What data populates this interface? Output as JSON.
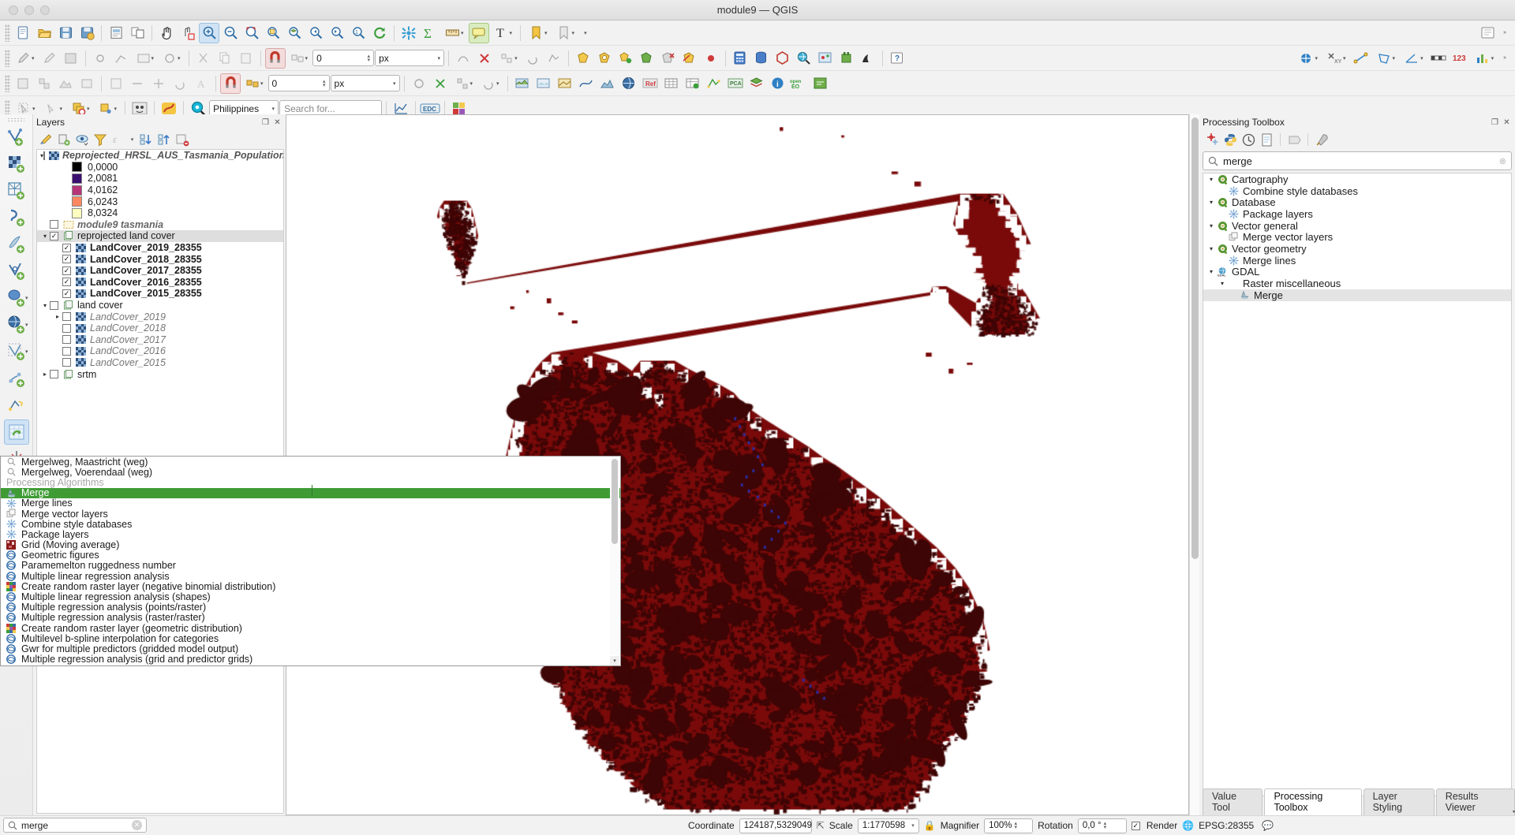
{
  "window": {
    "title": "module9 — QGIS"
  },
  "toolbar3": {
    "value": "0",
    "unit": "px",
    "country": "Philippines",
    "search_placeholder": "Search for..."
  },
  "layers_panel": {
    "title": "Layers",
    "tools": [
      "open-layer-styling",
      "add-group",
      "manage-visibility",
      "filter-legend",
      "expression-filter",
      "expand-all",
      "collapse-all",
      "remove-layer"
    ],
    "items": [
      {
        "label": "Reprojected_HRSL_AUS_Tasmania_Population",
        "style": "bolditalic",
        "indent": 0,
        "checkbox": "unchecked",
        "expander": "down",
        "icon": "raster"
      },
      {
        "label": "0,0000",
        "style": "swatch",
        "color": "#000000",
        "indent": 1
      },
      {
        "label": "2,0081",
        "style": "swatch",
        "color": "#3b0f70",
        "indent": 1
      },
      {
        "label": "4,0162",
        "style": "swatch",
        "color": "#b63679",
        "indent": 1
      },
      {
        "label": "6,0243",
        "style": "swatch",
        "color": "#fb8861",
        "indent": 1
      },
      {
        "label": "8,0324",
        "style": "swatch",
        "color": "#fcfdbf",
        "indent": 1
      },
      {
        "label": "module9 tasmania",
        "style": "grayitalic",
        "indent": 0,
        "checkbox": "unchecked",
        "icon": "vector-dashed"
      },
      {
        "label": "reprojected land cover",
        "style": "plain",
        "indent": 0,
        "checkbox": "checked",
        "expander": "down",
        "icon": "group",
        "selected": true
      },
      {
        "label": "LandCover_2019_28355",
        "style": "bold",
        "indent": 1,
        "checkbox": "checked",
        "icon": "raster"
      },
      {
        "label": "LandCover_2018_28355",
        "style": "bold",
        "indent": 1,
        "checkbox": "checked",
        "icon": "raster"
      },
      {
        "label": "LandCover_2017_28355",
        "style": "bold",
        "indent": 1,
        "checkbox": "checked",
        "icon": "raster"
      },
      {
        "label": "LandCover_2016_28355",
        "style": "bold",
        "indent": 1,
        "checkbox": "checked",
        "icon": "raster"
      },
      {
        "label": "LandCover_2015_28355",
        "style": "bold",
        "indent": 1,
        "checkbox": "checked",
        "icon": "raster"
      },
      {
        "label": "land cover",
        "style": "plain",
        "indent": 0,
        "checkbox": "unchecked",
        "expander": "down",
        "icon": "group"
      },
      {
        "label": "LandCover_2019",
        "style": "italic",
        "indent": 1,
        "checkbox": "unchecked",
        "expander": "right",
        "icon": "raster"
      },
      {
        "label": "LandCover_2018",
        "style": "italic",
        "indent": 1,
        "checkbox": "unchecked",
        "icon": "raster"
      },
      {
        "label": "LandCover_2017",
        "style": "italic",
        "indent": 1,
        "checkbox": "unchecked",
        "icon": "raster"
      },
      {
        "label": "LandCover_2016",
        "style": "italic",
        "indent": 1,
        "checkbox": "unchecked",
        "icon": "raster"
      },
      {
        "label": "LandCover_2015",
        "style": "italic",
        "indent": 1,
        "checkbox": "unchecked",
        "icon": "raster"
      },
      {
        "label": "srtm",
        "style": "plain",
        "indent": 0,
        "checkbox": "unchecked",
        "expander": "right",
        "icon": "group"
      }
    ]
  },
  "processing_panel": {
    "title": "Processing Toolbox",
    "search_value": "merge",
    "tools": [
      "models",
      "scripts",
      "history",
      "log",
      "edit-in-place",
      "options"
    ],
    "tree": [
      {
        "label": "Cartography",
        "kind": "provider",
        "indent": 0,
        "expander": "down"
      },
      {
        "label": "Combine style databases",
        "kind": "gear",
        "indent": 1
      },
      {
        "label": "Database",
        "kind": "provider",
        "indent": 0,
        "expander": "down"
      },
      {
        "label": "Package layers",
        "kind": "gear",
        "indent": 1
      },
      {
        "label": "Vector general",
        "kind": "provider",
        "indent": 0,
        "expander": "down"
      },
      {
        "label": "Merge vector layers",
        "kind": "layers",
        "indent": 1
      },
      {
        "label": "Vector geometry",
        "kind": "provider",
        "indent": 0,
        "expander": "down"
      },
      {
        "label": "Merge lines",
        "kind": "gear",
        "indent": 1
      },
      {
        "label": "GDAL",
        "kind": "gdal",
        "indent": 0,
        "expander": "down"
      },
      {
        "label": "Raster miscellaneous",
        "kind": "none",
        "indent": 1,
        "expander": "down"
      },
      {
        "label": "Merge",
        "kind": "merge",
        "indent": 2,
        "selected": true
      }
    ],
    "tabs": [
      {
        "label": "Value Tool",
        "active": false
      },
      {
        "label": "Processing Toolbox",
        "active": true
      },
      {
        "label": "Layer Styling",
        "active": false
      },
      {
        "label": "Results Viewer",
        "active": false
      }
    ]
  },
  "locator_popup": {
    "items": [
      {
        "label": "Mergelweg, Maastricht (weg)",
        "icon": "search",
        "type": "item"
      },
      {
        "label": "Mergelweg, Voerendaal (weg)",
        "icon": "search",
        "type": "item"
      },
      {
        "label": "Processing Algorithms",
        "type": "header"
      },
      {
        "label": "Merge",
        "icon": "merge",
        "type": "item",
        "highlight": true
      },
      {
        "label": "Merge lines",
        "icon": "gear",
        "type": "item"
      },
      {
        "label": "Merge vector layers",
        "icon": "layers",
        "type": "item"
      },
      {
        "label": "Combine style databases",
        "icon": "gear",
        "type": "item"
      },
      {
        "label": "Package layers",
        "icon": "gear",
        "type": "item"
      },
      {
        "label": "Grid (Moving average)",
        "icon": "grid",
        "type": "item"
      },
      {
        "label": "Geometric figures",
        "icon": "saga",
        "type": "item"
      },
      {
        "label": "Paramemelton ruggedness number",
        "icon": "saga",
        "type": "item"
      },
      {
        "label": "Multiple linear regression analysis",
        "icon": "saga",
        "type": "item"
      },
      {
        "label": "Create random raster layer (negative binomial distribution)",
        "icon": "raster",
        "type": "item"
      },
      {
        "label": "Multiple linear regression analysis (shapes)",
        "icon": "saga",
        "type": "item"
      },
      {
        "label": "Multiple regression analysis (points/raster)",
        "icon": "saga",
        "type": "item"
      },
      {
        "label": "Multiple regression analysis (raster/raster)",
        "icon": "saga",
        "type": "item"
      },
      {
        "label": "Create random raster layer (geometric distribution)",
        "icon": "raster",
        "type": "item"
      },
      {
        "label": "Multilevel b-spline interpolation for categories",
        "icon": "saga",
        "type": "item"
      },
      {
        "label": "Gwr for multiple predictors (gridded model output)",
        "icon": "saga",
        "type": "item"
      },
      {
        "label": "Multiple regression analysis (grid and predictor grids)",
        "icon": "saga",
        "type": "item"
      }
    ]
  },
  "bottom_search": {
    "value": "merge"
  },
  "statusbar": {
    "coordinate_label": "Coordinate",
    "coordinate_value": "124187,5329049",
    "scale_label": "Scale",
    "scale_value": "1:1770598",
    "magnifier_label": "Magnifier",
    "magnifier_value": "100%",
    "rotation_label": "Rotation",
    "rotation_value": "0,0 °",
    "render_label": "Render",
    "crs_label": "EPSG:28355"
  },
  "colors": {
    "highlight_green": "#3f9c35",
    "land_dark_red": "#7a0a0a",
    "land_darker": "#3d0505",
    "selection_gray": "#dedede"
  }
}
